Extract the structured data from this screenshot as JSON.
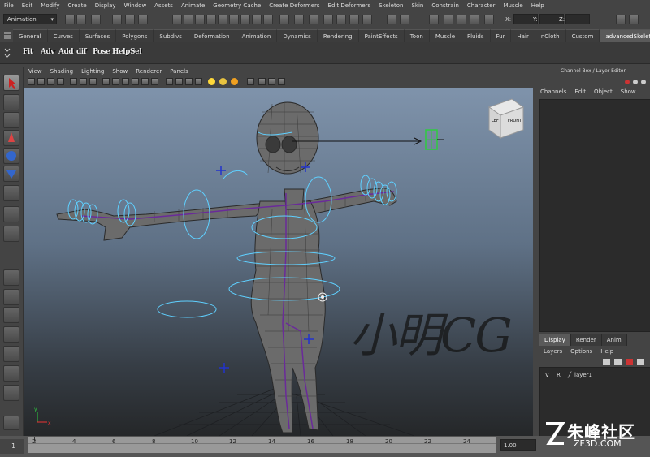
{
  "menubar": [
    "File",
    "Edit",
    "Modify",
    "Create",
    "Display",
    "Window",
    "Assets",
    "Animate",
    "Geometry Cache",
    "Create Deformers",
    "Edit Deformers",
    "Skeleton",
    "Skin",
    "Constrain",
    "Character",
    "Muscle",
    "Help"
  ],
  "statusline": {
    "mode": "Animation",
    "x_label": "X:",
    "y_label": "Y:",
    "z_label": "Z:"
  },
  "shelf_tabs": [
    "General",
    "Curves",
    "Surfaces",
    "Polygons",
    "Subdivs",
    "Deformation",
    "Animation",
    "Dynamics",
    "Rendering",
    "PaintEffects",
    "Toon",
    "Muscle",
    "Fluids",
    "Fur",
    "Hair",
    "nCloth",
    "Custom",
    "advancedSkeleton"
  ],
  "shelf_active_index": 17,
  "shelf_buttons": [
    "Fit",
    "Adv",
    "Add",
    "dif",
    "Pose Help",
    "Sel"
  ],
  "panel_menu": [
    "View",
    "Shading",
    "Lighting",
    "Show",
    "Renderer",
    "Panels"
  ],
  "view_cube": {
    "left": "LEFT",
    "front": "FRONT"
  },
  "channel_box": {
    "title": "Channel Box / Layer Editor",
    "menu": [
      "Channels",
      "Edit",
      "Object",
      "Show"
    ]
  },
  "layer_editor": {
    "tabs": [
      "Display",
      "Render",
      "Anim"
    ],
    "active_tab": 0,
    "menu": [
      "Layers",
      "Options",
      "Help"
    ],
    "layer": {
      "v": "V",
      "r": "R",
      "name": "layer1"
    }
  },
  "timeslider": {
    "start": "1",
    "ticks": [
      "2",
      "4",
      "6",
      "8",
      "10",
      "12",
      "14",
      "16",
      "18",
      "20",
      "22",
      "24"
    ],
    "current": "1.00"
  },
  "watermark": "小明CG",
  "logo": {
    "cn": "朱峰社区",
    "en": "ZF3D.COM"
  },
  "colors": {
    "viewport_top": "#7f93ab",
    "viewport_bottom": "#252729",
    "control_curve": "#5fd0ff",
    "joint": "#6a2a9a"
  }
}
